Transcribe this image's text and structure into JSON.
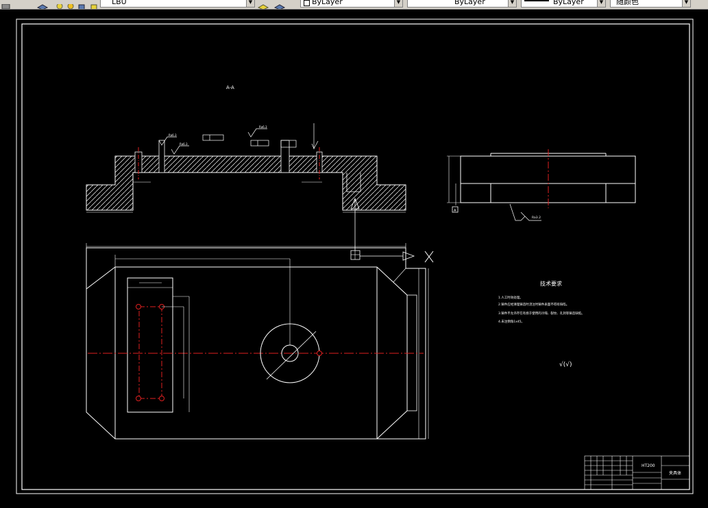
{
  "toolbar": {
    "layer_name": "LBU",
    "color_value": "ByLayer",
    "linetype_value": "ByLayer",
    "lineweight_value": "ByLayer",
    "plotstyle_value": "随颜色"
  },
  "drawing": {
    "section_label": "A-A",
    "roughness_values": [
      "Ra6.3",
      "Ra6.3",
      "Ra6.3",
      "Ra3.2",
      "Ra3.2"
    ],
    "datum_label": "A",
    "tech_req_title": "技术要求",
    "tech_req_items": [
      "1.人工时效处理。",
      "2.铸件应经清理铸造时浇注时铸件表面不得有缺陷。",
      "3.铸件不允许存在有损于使用的冷隔、裂纹、孔洞等铸造缺陷。",
      "4.未注倒角1x45。"
    ],
    "rest_roughness": "√(√)",
    "title_block": {
      "material": "HT200",
      "name": "夹具体"
    }
  }
}
